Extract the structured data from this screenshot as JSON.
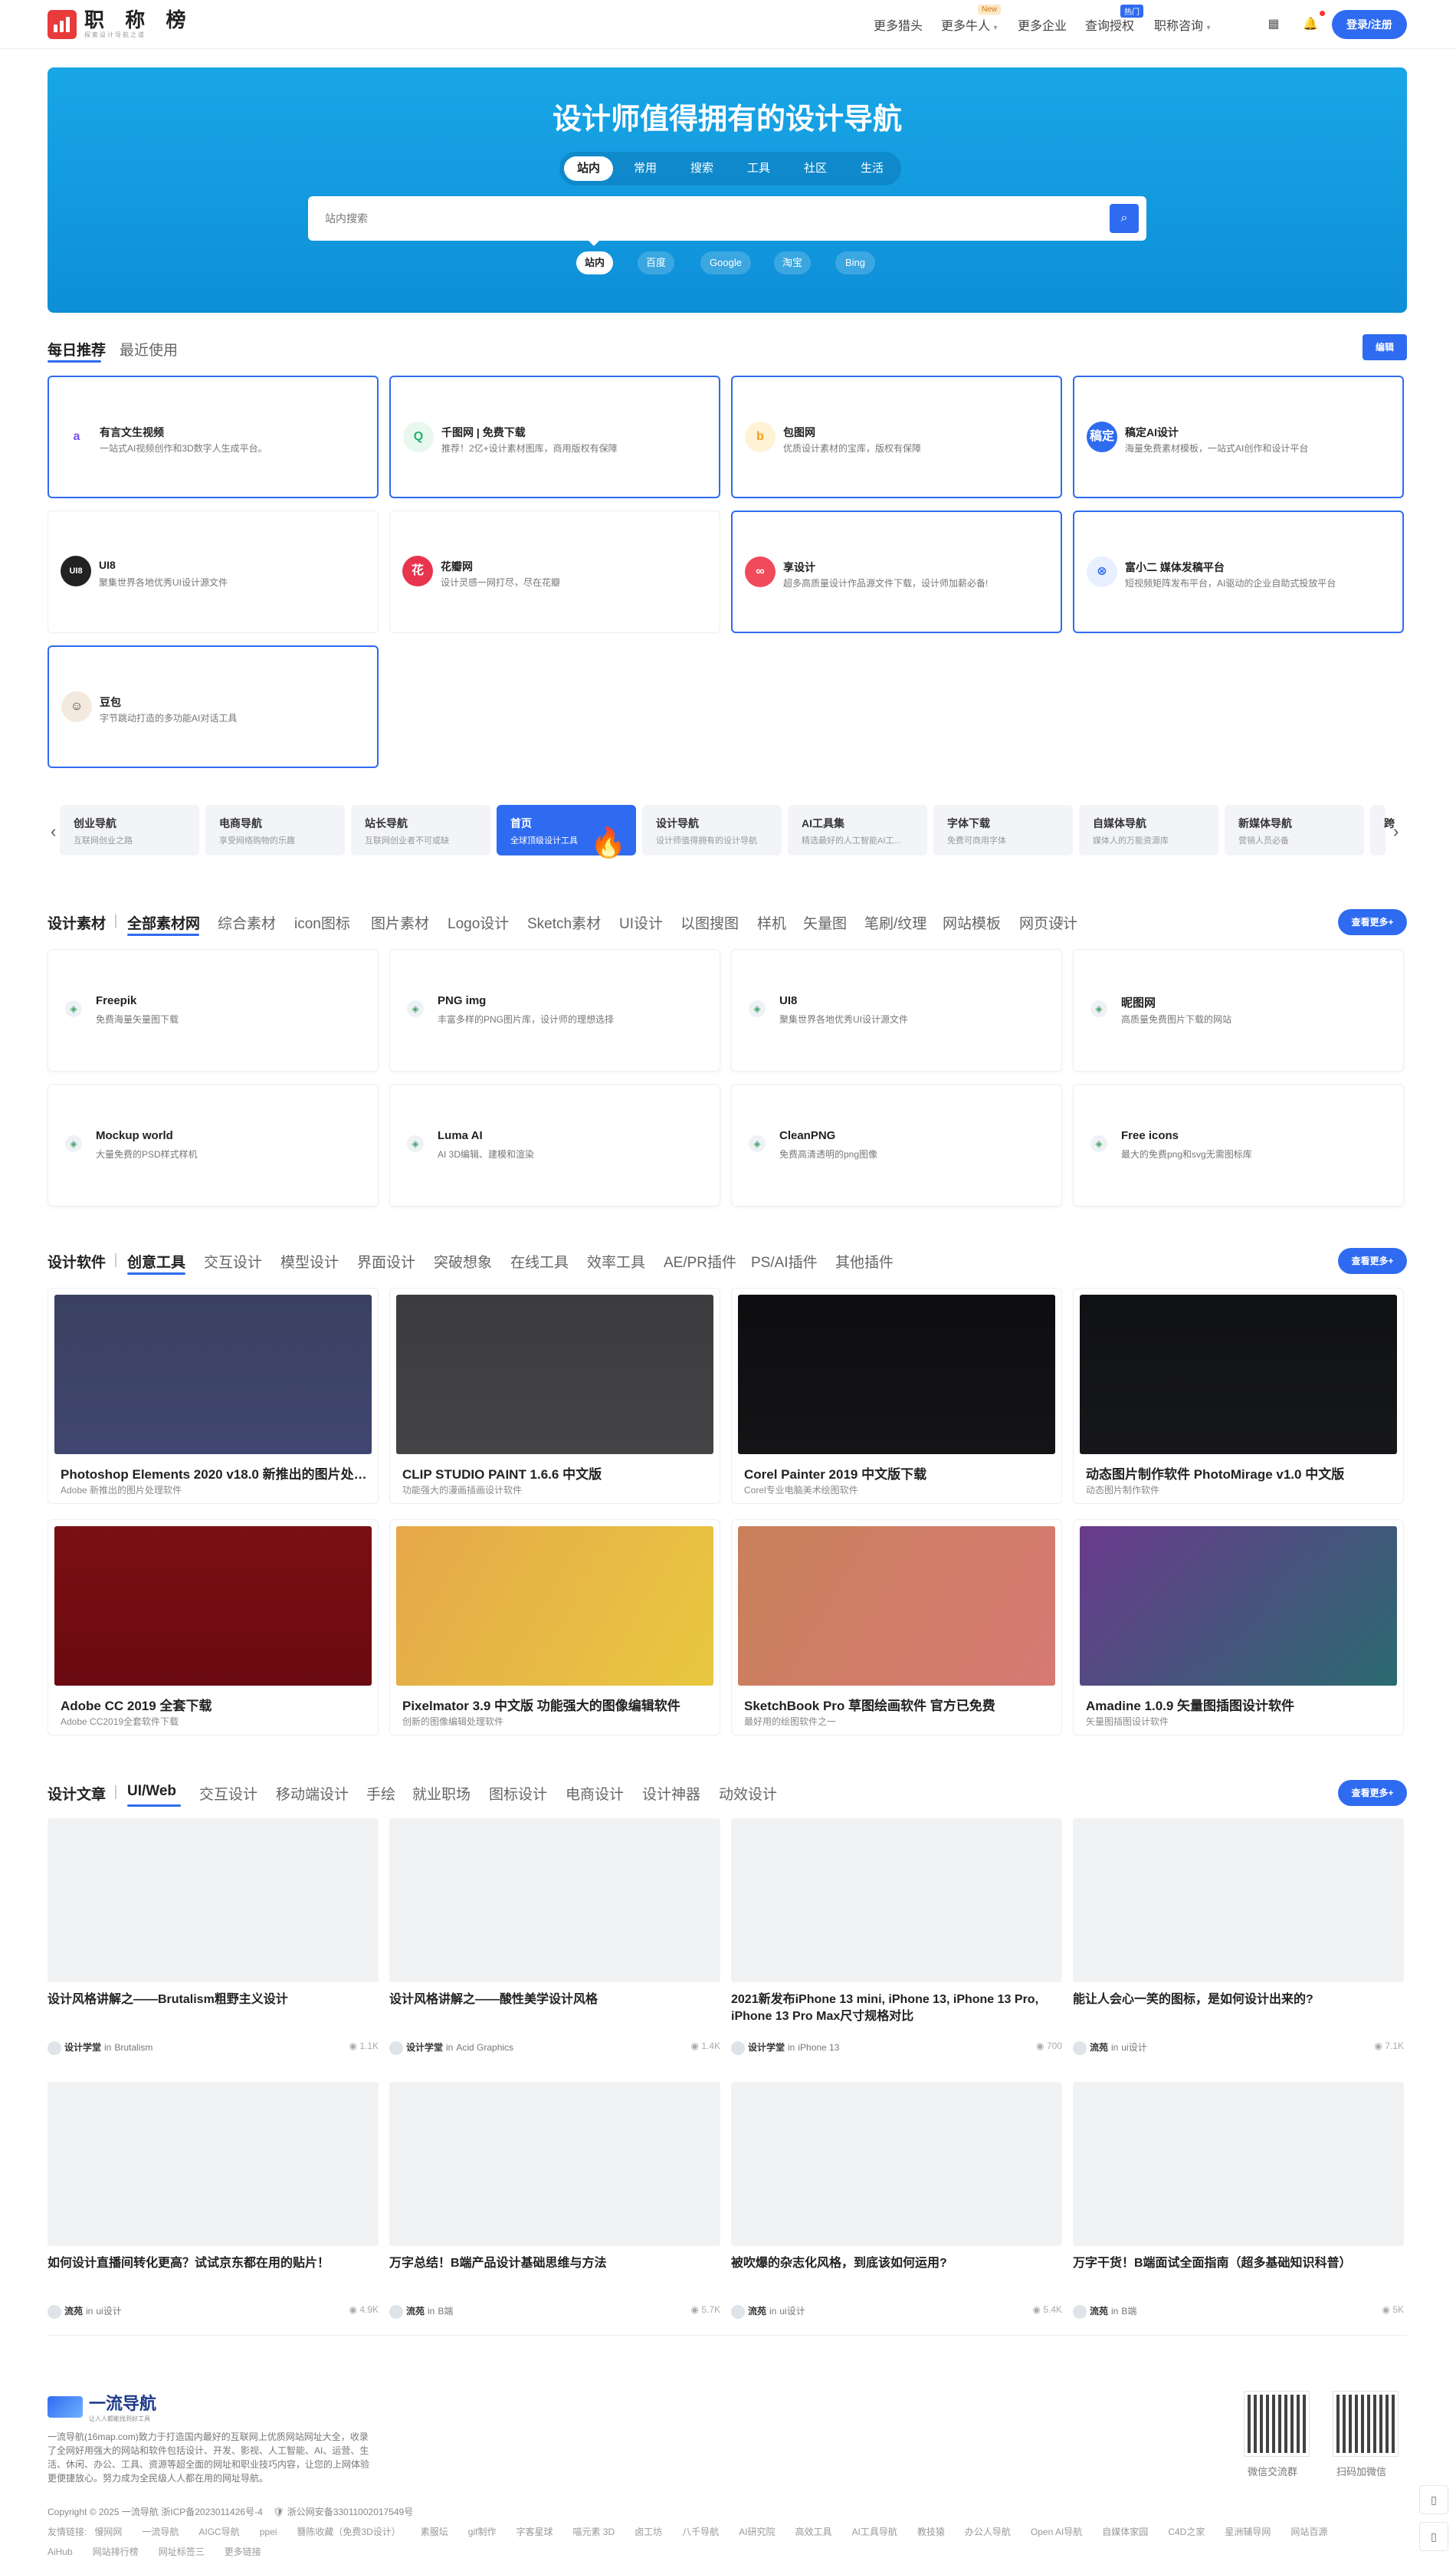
{
  "header": {
    "logo_title": "职 称 榜",
    "logo_sub": "探索设计导航之道",
    "nav": [
      "更多猎头",
      "更多牛人",
      "更多企业",
      "查询授权",
      "职称咨询"
    ],
    "badge_new": "New",
    "badge_hot": "热门",
    "login": "登录/注册"
  },
  "hero": {
    "title": "设计师值得拥有的设计导航",
    "tabs": [
      "站内",
      "常用",
      "搜索",
      "工具",
      "社区",
      "生活"
    ],
    "search_placeholder": "站内搜索",
    "engines": [
      "站内",
      "百度",
      "Google",
      "淘宝",
      "Bing"
    ]
  },
  "daily": {
    "tabs": [
      "每日推荐",
      "最近使用"
    ],
    "edit": "编辑",
    "cards": [
      {
        "title": "有言文生视频",
        "desc": "一站式AI视频创作和3D数字人生成平台。",
        "hl": true,
        "icon": "a",
        "color": "#7b4cf0",
        "bg": "#fff"
      },
      {
        "title": "千图网 | 免费下载",
        "desc": "推荐！2亿+设计素材图库，商用版权有保障",
        "hl": true,
        "icon": "Q",
        "color": "#1fb36b",
        "bg": "#e9f8ef"
      },
      {
        "title": "包图网",
        "desc": "优质设计素材的宝库，版权有保障",
        "hl": true,
        "icon": "b",
        "color": "#f39c12",
        "bg": "#fff3d6"
      },
      {
        "title": "稿定AI设计",
        "desc": "海量免费素材模板，一站式AI创作和设计平台",
        "hl": true,
        "icon": "稿定",
        "color": "#fff",
        "bg": "#2f6bf0"
      },
      {
        "title": "UI8",
        "desc": "聚集世界各地优秀UI设计源文件",
        "hl": false,
        "icon": "UI8",
        "color": "#fff",
        "bg": "#222"
      },
      {
        "title": "花瓣网",
        "desc": "设计灵感一网打尽，尽在花瓣",
        "hl": false,
        "icon": "花",
        "color": "#fff",
        "bg": "#e8344e"
      },
      {
        "title": "享设计",
        "desc": "超多高质量设计作品源文件下载，设计师加薪必备!",
        "hl": true,
        "icon": "∞",
        "color": "#fff",
        "bg": "#f04a5b"
      },
      {
        "title": "富小二 媒体发稿平台",
        "desc": "短视频矩阵发布平台，AI驱动的企业自助式投放平台",
        "hl": true,
        "icon": "⊗",
        "color": "#2f6bf0",
        "bg": "#e8f0ff"
      },
      {
        "title": "豆包",
        "desc": "字节跳动打造的多功能AI对话工具",
        "hl": true,
        "icon": "☺",
        "color": "#333",
        "bg": "#f4e9df"
      }
    ]
  },
  "strip": [
    {
      "title": "创业导航",
      "desc": "互联网创业之路"
    },
    {
      "title": "电商导航",
      "desc": "享受网络购物的乐趣"
    },
    {
      "title": "站长导航",
      "desc": "互联网创业者不可或缺"
    },
    {
      "title": "首页",
      "desc": "全球顶级设计工具"
    },
    {
      "title": "设计导航",
      "desc": "设计师值得拥有的设计导航"
    },
    {
      "title": "AI工具集",
      "desc": "精选最好的人工智能AI工..."
    },
    {
      "title": "字体下载",
      "desc": "免费可商用字体"
    },
    {
      "title": "自媒体导航",
      "desc": "媒体人的万能资源库"
    },
    {
      "title": "新媒体导航",
      "desc": "营销人员必备"
    },
    {
      "title": "跨",
      "desc": ""
    }
  ],
  "materials": {
    "label": "设计素材",
    "tabs": [
      "全部素材网",
      "综合素材",
      "icon图标",
      "图片素材",
      "Logo设计",
      "Sketch素材",
      "UI设计",
      "以图搜图",
      "样机",
      "矢量图",
      "笔刷/纹理",
      "网站模板",
      "网页设计"
    ],
    "more": "查看更多+",
    "cards": [
      {
        "title": "Freepik",
        "desc": "免费海量矢量图下载"
      },
      {
        "title": "PNG img",
        "desc": "丰富多样的PNG图片库，设计师的理想选择"
      },
      {
        "title": "UI8",
        "desc": "聚集世界各地优秀UI设计源文件"
      },
      {
        "title": "昵图网",
        "desc": "高质量免费图片下载的网站"
      },
      {
        "title": "Mockup world",
        "desc": "大量免费的PSD样式样机"
      },
      {
        "title": "Luma AI",
        "desc": "AI 3D编辑、建模和渲染"
      },
      {
        "title": "CleanPNG",
        "desc": "免费高清透明的png图像"
      },
      {
        "title": "Free icons",
        "desc": "最大的免费png和svg无需图标库"
      }
    ]
  },
  "software": {
    "label": "设计软件",
    "tabs": [
      "创意工具",
      "交互设计",
      "模型设计",
      "界面设计",
      "突破想象",
      "在线工具",
      "效率工具",
      "AE/PR插件",
      "PS/AI插件",
      "其他插件"
    ],
    "more": "查看更多+",
    "cards": [
      {
        "title": "Photoshop Elements 2020 v18.0 新推出的图片处理软件",
        "desc": "Adobe 新推出的图片处理软件",
        "img": "linear-gradient(180deg,#3a4160,#404670)"
      },
      {
        "title": "CLIP STUDIO PAINT 1.6.6 中文版",
        "desc": "功能强大的漫画插画设计软件",
        "img": "linear-gradient(180deg,#3c3c3e,#444446)"
      },
      {
        "title": "Corel Painter 2019 中文版下载",
        "desc": "Corel专业电脑美术绘图软件",
        "img": "linear-gradient(180deg,#0e0e10,#141416)"
      },
      {
        "title": "动态图片制作软件 PhotoMirage v1.0 中文版",
        "desc": "动态图片制作软件",
        "img": "linear-gradient(180deg,#101114,#16171a)"
      },
      {
        "title": "Adobe CC 2019 全套下载",
        "desc": "Adobe CC2019全套软件下载",
        "img": "linear-gradient(180deg,#7a0f14,#6a0a10)"
      },
      {
        "title": "Pixelmator 3.9 中文版 功能强大的图像编辑软件",
        "desc": "创新的图像编辑处理软件",
        "img": "linear-gradient(120deg,#e6a84a,#e8c840)"
      },
      {
        "title": "SketchBook Pro 草图绘画软件 官方已免费",
        "desc": "最好用的绘图软件之一",
        "img": "linear-gradient(120deg,#c9805a,#d67a74)"
      },
      {
        "title": "Amadine 1.0.9 矢量图插图设计软件",
        "desc": "矢量图插图设计软件",
        "img": "linear-gradient(135deg,#6a3a8c,#2a6a70)"
      }
    ]
  },
  "articles": {
    "label": "设计文章",
    "tabs": [
      "UI/Web",
      "交互设计",
      "移动端设计",
      "手绘",
      "就业职场",
      "图标设计",
      "电商设计",
      "设计神器",
      "动效设计"
    ],
    "more": "查看更多+",
    "in_word": "in",
    "cards": [
      {
        "title": "设计风格讲解之——Brutalism粗野主义设计",
        "author": "设计学堂",
        "cat": "Brutalism",
        "views": "1.1K"
      },
      {
        "title": "设计风格讲解之——酸性美学设计风格",
        "author": "设计学堂",
        "cat": "Acid Graphics",
        "views": "1.4K"
      },
      {
        "title": "2021新发布iPhone 13 mini, iPhone 13, iPhone 13 Pro, iPhone 13 Pro Max尺寸规格对比",
        "author": "设计学堂",
        "cat": "iPhone 13",
        "views": "700"
      },
      {
        "title": "能让人会心一笑的图标，是如何设计出来的?",
        "author": "流苑",
        "cat": "ui设计",
        "views": "7.1K"
      },
      {
        "title": "如何设计直播间转化更高？试试京东都在用的贴片！",
        "author": "流苑",
        "cat": "ui设计",
        "views": "4.9K"
      },
      {
        "title": "万字总结！B端产品设计基础思维与方法",
        "author": "流苑",
        "cat": "B端",
        "views": "5.7K"
      },
      {
        "title": "被吹爆的杂志化风格，到底该如何运用?",
        "author": "流苑",
        "cat": "ui设计",
        "views": "5.4K"
      },
      {
        "title": "万字干货！B端面试全面指南（超多基础知识科普）",
        "author": "流苑",
        "cat": "B端",
        "views": "5K"
      }
    ]
  },
  "footer": {
    "logo_title": "一流导航",
    "logo_sub": "让人人都能找到好工具",
    "desc": "一流导航(16map.com)致力于打造国内最好的互联网上优质网站网址大全，收录了全网好用强大的网站和软件包括设计、开发、影视、人工智能、AI、运营、生活、休闲、办公、工具、资源等超全面的网址和职业技巧内容，让您的上网体验更便捷放心。努力成为全民级人人都在用的网址导航。",
    "copyright": "Copyright © 2025 一流导航  浙ICP备2023011426号-4",
    "police": "浙公网安备33011002017549号",
    "links_label": "友情链接:",
    "links": [
      "慢网网",
      "一流导航",
      "AIGC导航",
      "ppei",
      "簪陈收藏（免费3D设计）",
      "素服坛",
      "gif制作",
      "字客星球",
      "喵元素 3D",
      "卤工坊",
      "八千导航",
      "AI研究院",
      "高效工具",
      "AI工具导航",
      "教技猿",
      "办公人导航",
      "Open AI导航",
      "自媒体家园",
      "C4D之家",
      "星洲辅导网",
      "网站百源",
      "AiHub",
      "网站排行榜",
      "网址标签三",
      "更多链接"
    ],
    "qr1": "微信交流群",
    "qr2": "扫码加微信"
  },
  "colors": {
    "accent": "#2f6bf0",
    "hero": "#18a6e6",
    "brand_red": "#e83b3b"
  }
}
